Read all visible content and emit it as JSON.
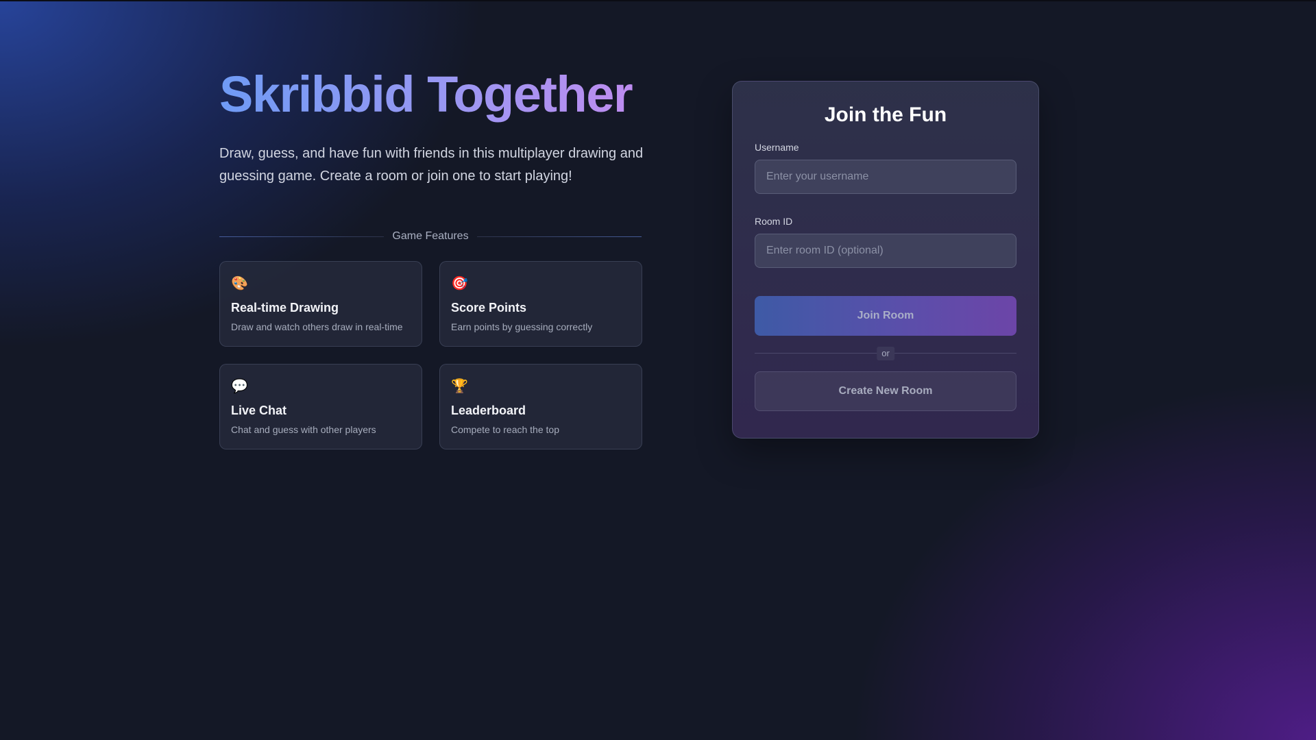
{
  "hero": {
    "title": "Skribbid Together",
    "subtitle": "Draw, guess, and have fun with friends in this multiplayer drawing and guessing game. Create a room or join one to start playing!"
  },
  "features": {
    "heading": "Game Features",
    "items": [
      {
        "icon": "🎨",
        "icon_name": "palette-icon",
        "title": "Real-time Drawing",
        "description": "Draw and watch others draw in real-time"
      },
      {
        "icon": "🎯",
        "icon_name": "target-icon",
        "title": "Score Points",
        "description": "Earn points by guessing correctly"
      },
      {
        "icon": "💬",
        "icon_name": "speech-bubble-icon",
        "title": "Live Chat",
        "description": "Chat and guess with other players"
      },
      {
        "icon": "🏆",
        "icon_name": "trophy-icon",
        "title": "Leaderboard",
        "description": "Compete to reach the top"
      }
    ]
  },
  "join_panel": {
    "title": "Join the Fun",
    "username": {
      "label": "Username",
      "placeholder": "Enter your username",
      "value": ""
    },
    "room_id": {
      "label": "Room ID",
      "placeholder": "Enter room ID (optional)",
      "value": ""
    },
    "join_button": "Join Room",
    "divider_text": "or",
    "create_button": "Create New Room"
  },
  "colors": {
    "title_gradient_start": "#6f9bf5",
    "title_gradient_end": "#c08cf0",
    "join_button_start": "#3e5aa6",
    "join_button_end": "#6c45a8"
  }
}
